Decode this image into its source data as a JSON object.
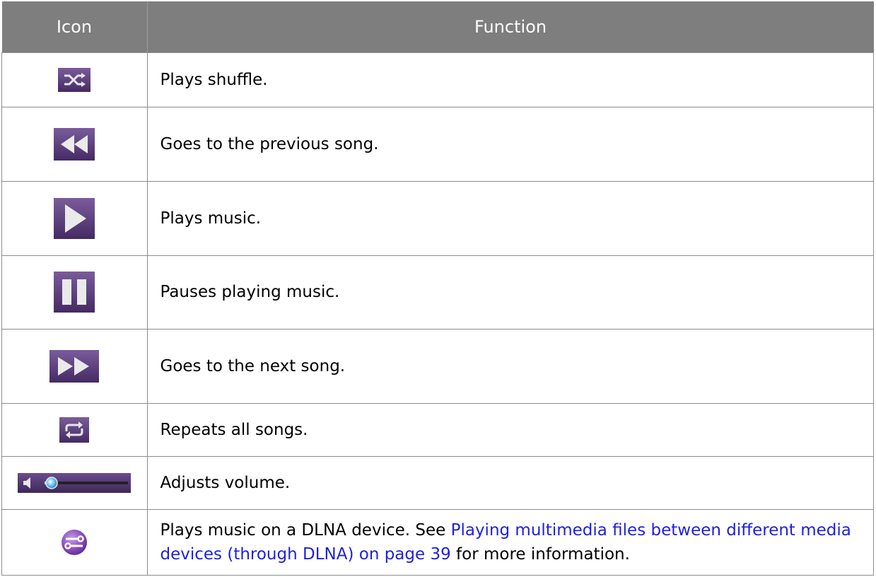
{
  "table": {
    "headers": {
      "icon": "Icon",
      "function": "Function"
    },
    "rows": [
      {
        "icon": "shuffle-icon",
        "text": "Plays shuffle."
      },
      {
        "icon": "previous-song-icon",
        "text": "Goes to the previous song."
      },
      {
        "icon": "play-icon",
        "text": "Plays music."
      },
      {
        "icon": "pause-icon",
        "text": "Pauses playing music."
      },
      {
        "icon": "next-song-icon",
        "text": "Goes to the next song."
      },
      {
        "icon": "repeat-icon",
        "text": "Repeats all songs."
      },
      {
        "icon": "volume-slider-icon",
        "text": "Adjusts volume."
      },
      {
        "icon": "dlna-icon",
        "text_before": "Plays music on a DLNA device. See ",
        "link": "Playing multimedia files between different media devices (through DLNA) on page 39",
        "text_after": " for more information."
      }
    ]
  },
  "colors": {
    "header_bg": "#7e7e7e",
    "icon_purple": "#5a3d7a",
    "link": "#1f1fe0",
    "volume_knob": "#3aa8e0"
  }
}
